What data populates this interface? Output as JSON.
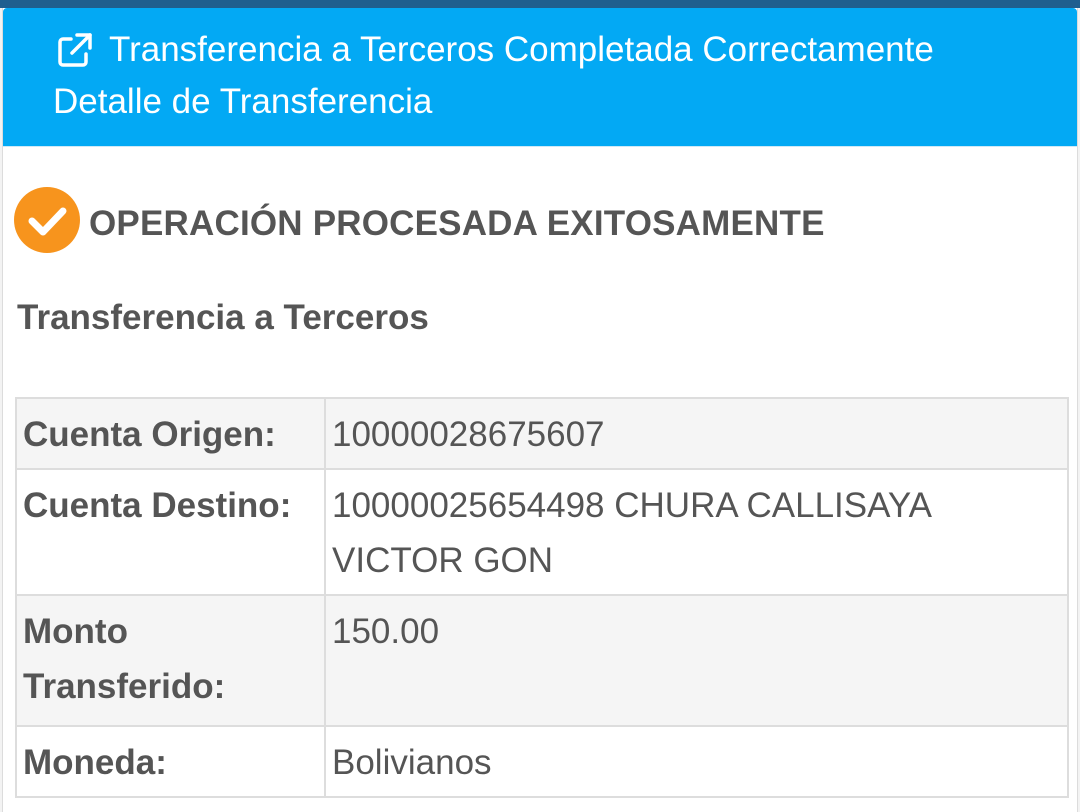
{
  "header": {
    "title": "Transferencia a Terceros Completada Correctamente",
    "subtitle": "Detalle de Transferencia",
    "icon": "external-link-icon"
  },
  "status": {
    "icon": "check-circle-icon",
    "icon_color": "#f7941d",
    "message": "OPERACIÓN PROCESADA EXITOSAMENTE"
  },
  "section_title": "Transferencia a Terceros",
  "details": [
    {
      "label": "Cuenta Origen:",
      "value": "10000028675607"
    },
    {
      "label": "Cuenta Destino:",
      "value": "10000025654498 CHURA CALLISAYA VICTOR GON"
    },
    {
      "label": "Monto Transferido:",
      "value": "150.00"
    },
    {
      "label": "Moneda:",
      "value": "Bolivianos"
    }
  ],
  "colors": {
    "header_bg": "#03a9f4",
    "text": "#555555",
    "accent": "#f7941d"
  }
}
